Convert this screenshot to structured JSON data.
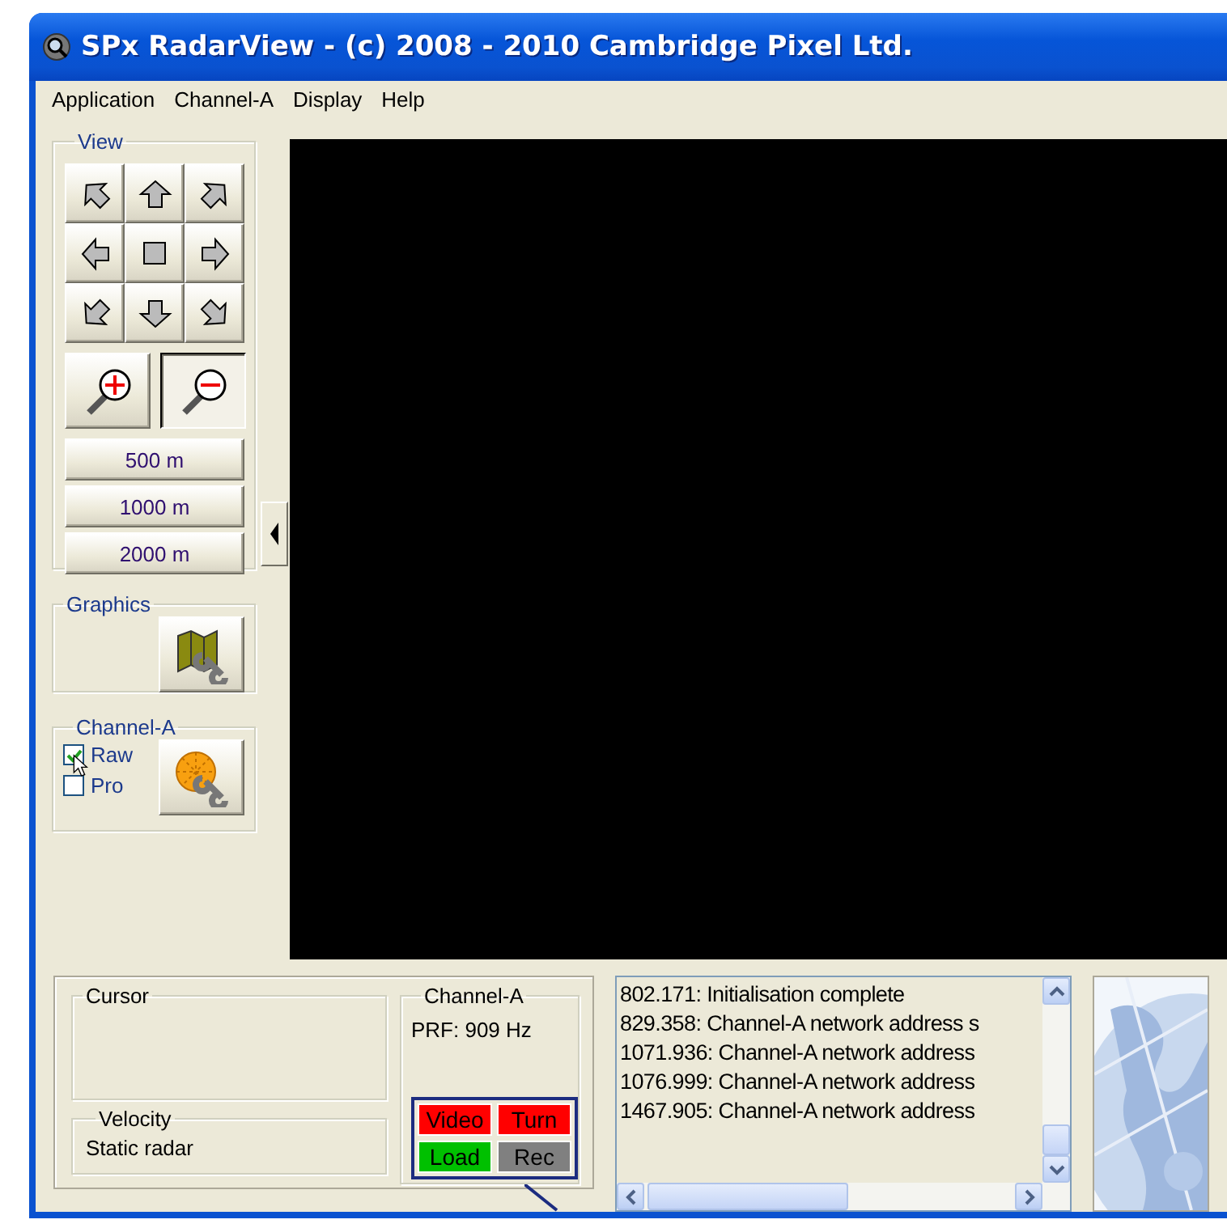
{
  "window": {
    "title": "SPx RadarView - (c) 2008 - 2010 Cambridge Pixel Ltd."
  },
  "menu": [
    "Application",
    "Channel-A",
    "Display",
    "Help"
  ],
  "view": {
    "title": "View",
    "zoom": [
      {
        "kind": "in",
        "pressed": false
      },
      {
        "kind": "out",
        "pressed": true
      }
    ],
    "ranges": [
      "500 m",
      "1000 m",
      "2000 m"
    ]
  },
  "graphics": {
    "title": "Graphics"
  },
  "channel": {
    "title": "Channel-A",
    "options": [
      {
        "label": "Raw",
        "checked": true
      },
      {
        "label": "Pro",
        "checked": false
      }
    ]
  },
  "cursor": {
    "title": "Cursor"
  },
  "velocity": {
    "title": "Velocity",
    "value": "Static radar"
  },
  "channel_status": {
    "title": "Channel-A",
    "prf": "PRF: 909 Hz",
    "indicators": [
      {
        "label": "Video",
        "color": "#ff0000"
      },
      {
        "label": "Turn",
        "color": "#ff0000"
      },
      {
        "label": "Load",
        "color": "#00c000"
      },
      {
        "label": "Rec",
        "color": "#808080"
      }
    ]
  },
  "log": [
    "802.171: Initialisation complete",
    "829.358: Channel-A network address s",
    "1071.936: Channel-A network address",
    "1076.999: Channel-A network address",
    "1467.905: Channel-A network address"
  ]
}
